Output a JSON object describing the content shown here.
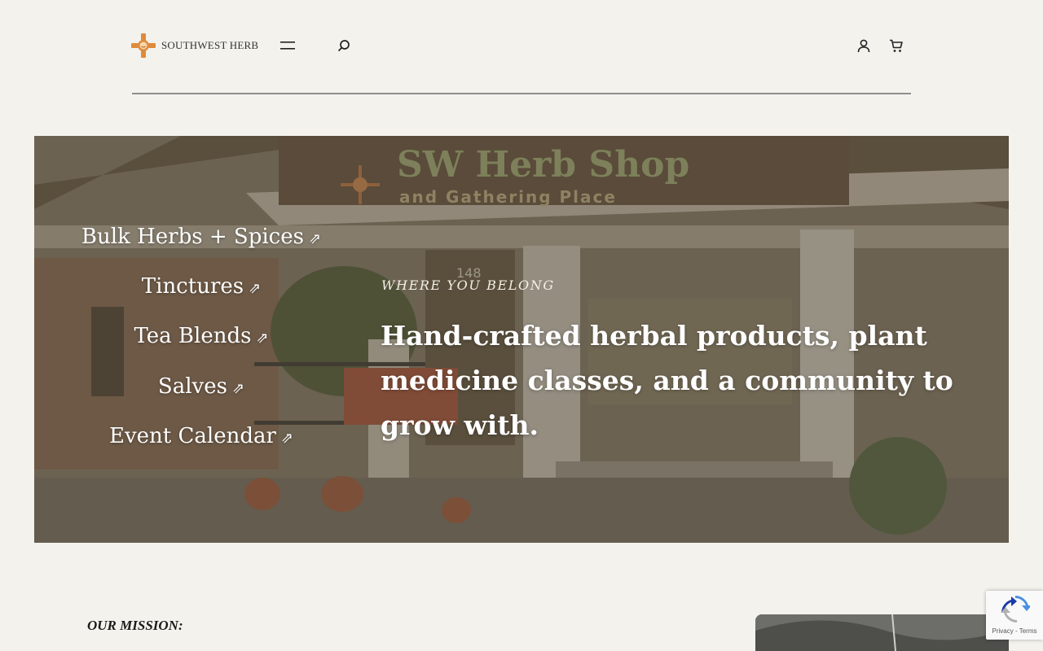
{
  "header": {
    "brand": "SOUTHWEST HERB",
    "icons": {
      "menu": "hamburger-menu-icon",
      "search": "search-icon",
      "account": "user-icon",
      "cart": "cart-icon"
    }
  },
  "hero": {
    "nav_links": [
      {
        "label": "Bulk Herbs + Spices",
        "arrow": "⇗"
      },
      {
        "label": "Tinctures",
        "arrow": "⇗"
      },
      {
        "label": "Tea Blends",
        "arrow": "⇗"
      },
      {
        "label": "Salves",
        "arrow": "⇗"
      },
      {
        "label": "Event Calendar",
        "arrow": "⇗"
      }
    ],
    "eyebrow": "WHERE YOU BELONG",
    "headline": "Hand-crafted herbal products, plant medicine classes, and a community to grow with.",
    "photo_sign_line1": "SW Herb Shop",
    "photo_sign_line2": "and Gathering Place",
    "photo_house_number": "148"
  },
  "mission": {
    "label": "OUR MISSION:"
  },
  "recaptcha": {
    "links": "Privacy - Terms"
  },
  "colors": {
    "background": "#f3f2ed",
    "logo_orange": "#e08a3c",
    "overlay": "#46403a",
    "text": "#222222"
  }
}
